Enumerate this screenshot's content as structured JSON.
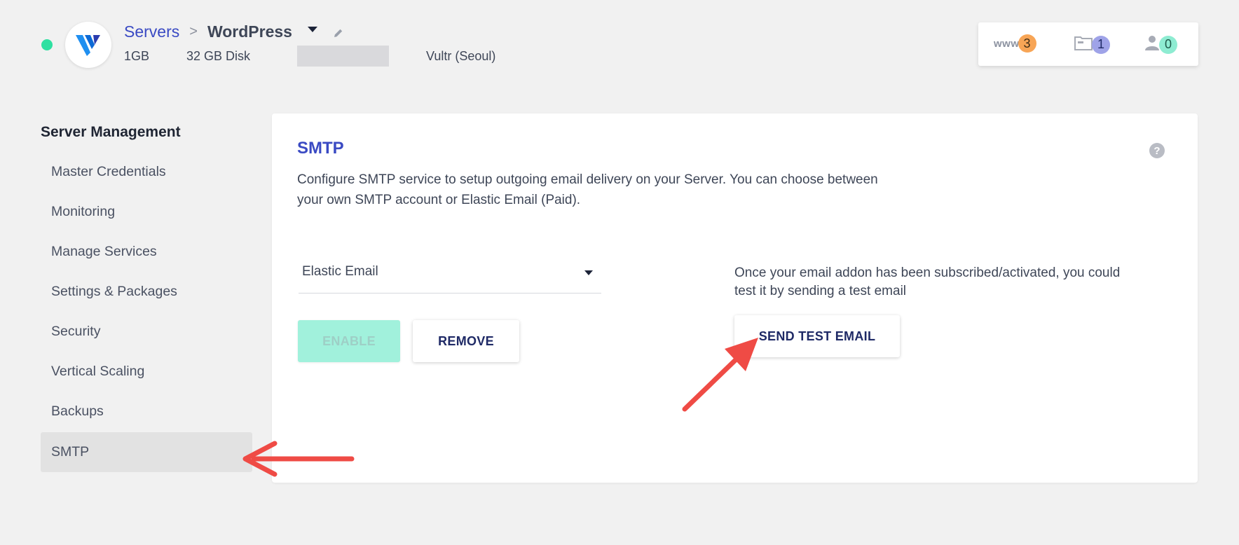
{
  "header": {
    "breadcrumb_root": "Servers",
    "breadcrumb_sep": ">",
    "breadcrumb_current": "WordPress",
    "server_size": "1GB",
    "server_disk": "32 GB Disk",
    "server_ip_prefix": "",
    "server_location": "Vultr (Seoul)",
    "status_color": "#2ee0a1"
  },
  "counters": {
    "www_label": "www",
    "www_count": "3",
    "apps_count": "1",
    "users_count": "0"
  },
  "sidebar": {
    "title": "Server Management",
    "items": [
      {
        "label": "Master Credentials"
      },
      {
        "label": "Monitoring"
      },
      {
        "label": "Manage Services"
      },
      {
        "label": "Settings & Packages"
      },
      {
        "label": "Security"
      },
      {
        "label": "Vertical Scaling"
      },
      {
        "label": "Backups"
      },
      {
        "label": "SMTP",
        "active": true
      }
    ]
  },
  "panel": {
    "title": "SMTP",
    "description": "Configure SMTP service to setup outgoing email delivery on your Server. You can choose between your own SMTP account or Elastic Email (Paid).",
    "help_icon": "?",
    "provider_select_value": "Elastic Email",
    "enable_label": "ENABLE",
    "remove_label": "REMOVE",
    "send_note": "Once your email addon has been subscribed/activated, you could test it by sending a test email",
    "send_test_label": "SEND TEST EMAIL"
  },
  "colors": {
    "accent": "#3a4ac3",
    "enable_bg": "#a1f1dc",
    "annotation_arrow": "#ef4b45",
    "www_badge": "#f7a556",
    "apps_badge": "#9fa3e8",
    "users_badge": "#8eecd2"
  }
}
